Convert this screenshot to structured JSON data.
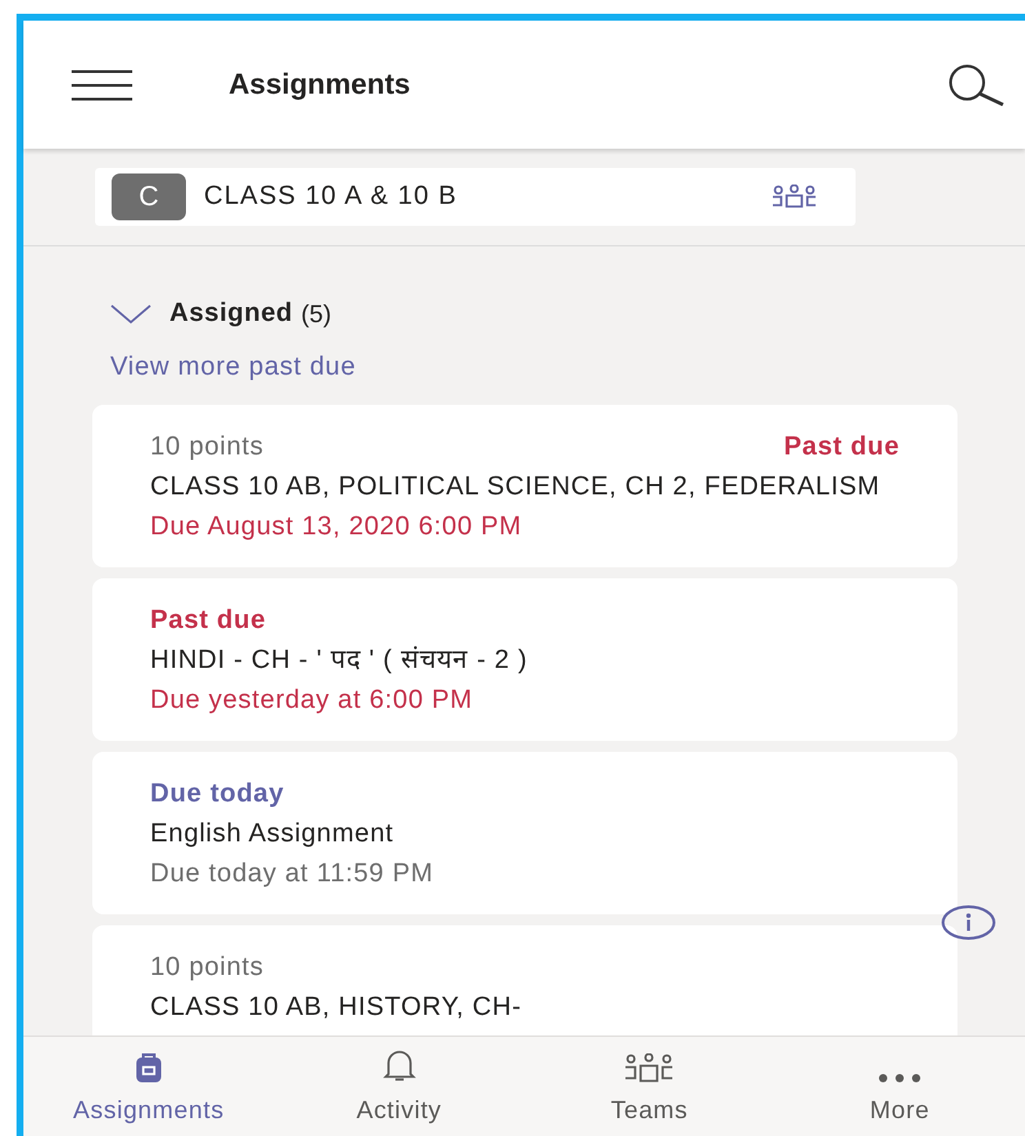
{
  "header": {
    "title": "Assignments"
  },
  "class_selector": {
    "avatar": "C",
    "name": "CLASS 10 A & 10 B"
  },
  "section": {
    "title": "Assigned",
    "count": "(5)",
    "expanded": true,
    "link": "View more past due"
  },
  "assignments": [
    {
      "points": "10 points",
      "status": {
        "kind": "past_due",
        "label": "Past due"
      },
      "title": "CLASS 10 AB, POLITICAL SCIENCE, CH 2, FEDERALISM",
      "due": {
        "kind": "overdue",
        "text": "Due August 13, 2020 6:00 PM"
      }
    },
    {
      "status": {
        "kind": "past_due",
        "label": "Past due"
      },
      "title": "HINDI - CH - ' पद ' ( संचयन - 2 )",
      "due": {
        "kind": "overdue",
        "text": "Due yesterday at 6:00 PM"
      }
    },
    {
      "status": {
        "kind": "due_today",
        "label": "Due today"
      },
      "title": "English Assignment",
      "due": {
        "kind": "normal",
        "text": "Due today at 11:59 PM"
      }
    },
    {
      "points": "10 points",
      "title": "CLASS 10 AB, HISTORY, CH-"
    }
  ],
  "tab_bar": [
    {
      "kind": "assignments",
      "label": "Assignments",
      "selected": true
    },
    {
      "kind": "activity",
      "label": "Activity",
      "selected": false
    },
    {
      "kind": "teams",
      "label": "Teams",
      "selected": false
    },
    {
      "kind": "more",
      "label": "More",
      "selected": false
    }
  ]
}
